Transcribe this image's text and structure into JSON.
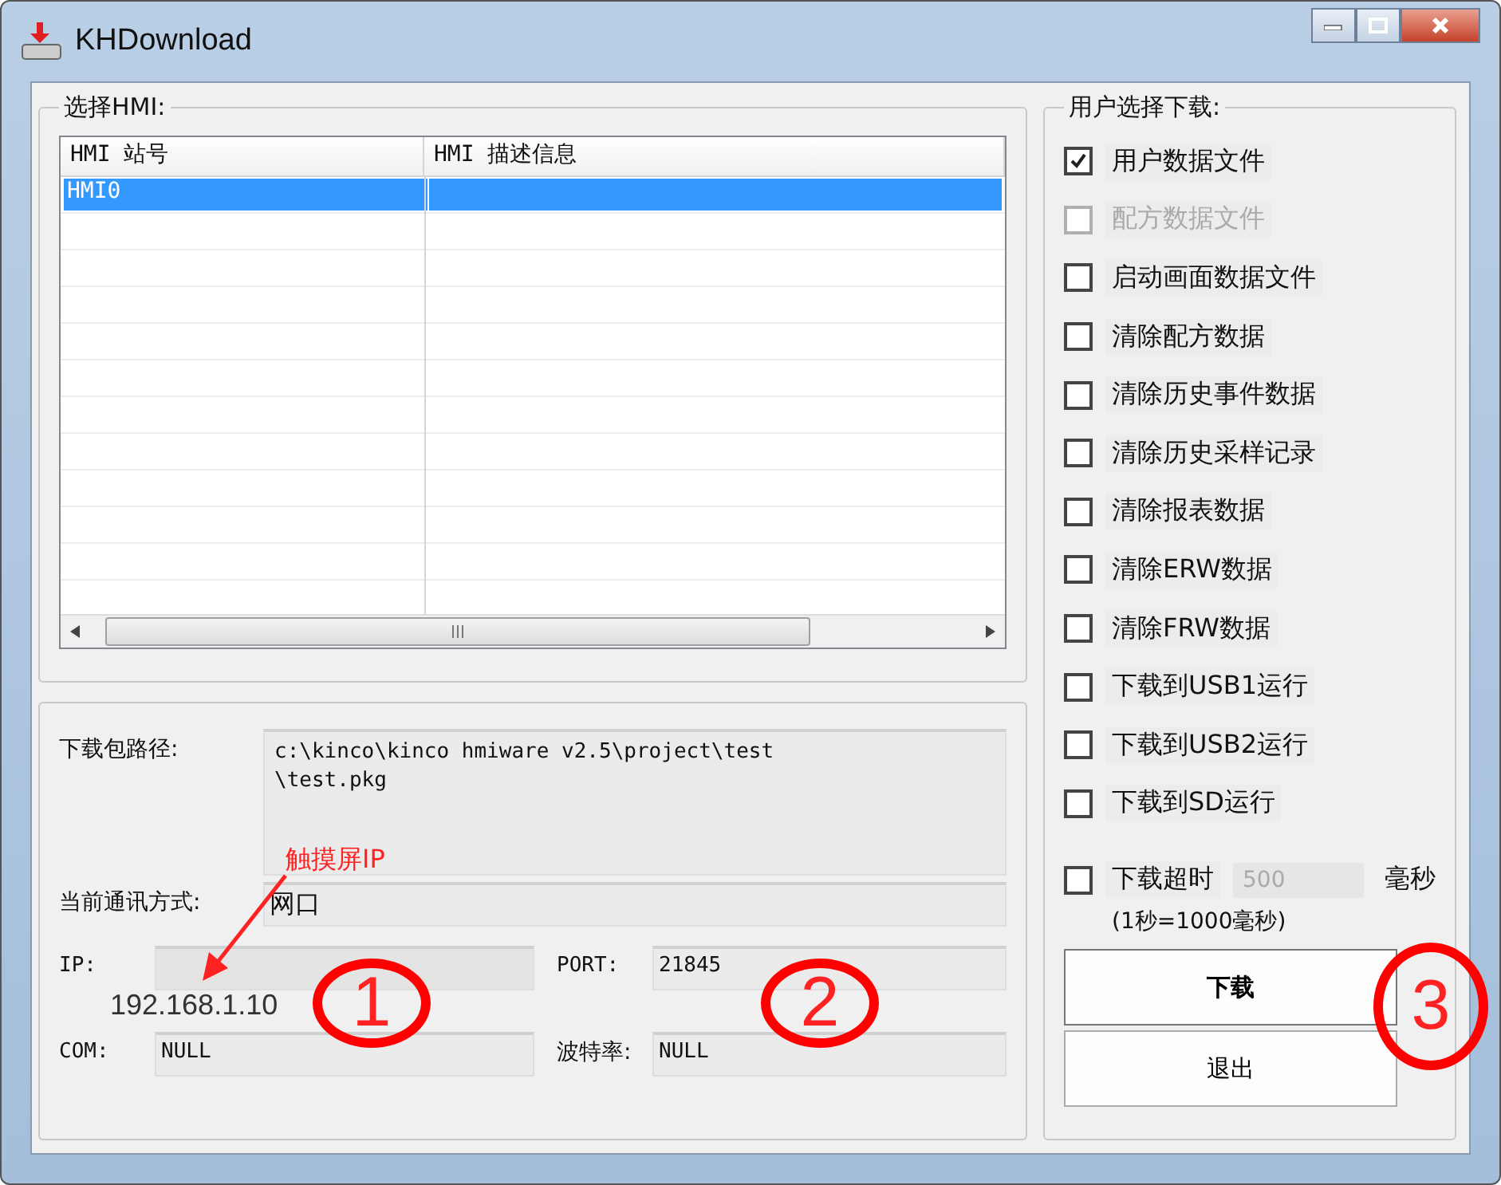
{
  "window": {
    "title": "KHDownload"
  },
  "hmi_group": {
    "title": "选择HMI:",
    "columns": [
      "HMI 站号",
      "HMI 描述信息"
    ],
    "rows": [
      {
        "station": "HMI0",
        "selected": true
      }
    ]
  },
  "connection": {
    "path_label": "下载包路径:",
    "path_value": "c:\\kinco\\kinco hmiware v2.5\\project\\test\n\\test.pkg",
    "mode_label": "当前通讯方式:",
    "mode_value": "网口",
    "ip_label": "IP:",
    "port_label": "PORT:",
    "port_value": "21845",
    "com_label": "COM:",
    "com_value": "NULL",
    "baud_label": "波特率:",
    "baud_value": "NULL"
  },
  "download_options": {
    "title": "用户选择下载:",
    "options": [
      {
        "label": "用户数据文件",
        "checked": true,
        "disabled": false
      },
      {
        "label": "配方数据文件",
        "checked": false,
        "disabled": true
      },
      {
        "label": "启动画面数据文件",
        "checked": false,
        "disabled": false
      },
      {
        "label": "清除配方数据",
        "checked": false,
        "disabled": false
      },
      {
        "label": "清除历史事件数据",
        "checked": false,
        "disabled": false
      },
      {
        "label": "清除历史采样记录",
        "checked": false,
        "disabled": false
      },
      {
        "label": "清除报表数据",
        "checked": false,
        "disabled": false
      },
      {
        "label": "清除ERW数据",
        "checked": false,
        "disabled": false
      },
      {
        "label": "清除FRW数据",
        "checked": false,
        "disabled": false
      },
      {
        "label": "下载到USB1运行",
        "checked": false,
        "disabled": false
      },
      {
        "label": "下载到USB2运行",
        "checked": false,
        "disabled": false
      },
      {
        "label": "下载到SD运行",
        "checked": false,
        "disabled": false
      }
    ],
    "timeout": {
      "label": "下载超时",
      "checked": false,
      "value": "500",
      "unit": "毫秒",
      "note": "(1秒=1000毫秒)"
    },
    "buttons": [
      {
        "label": "下载",
        "default": true
      },
      {
        "label": "退出",
        "default": false
      }
    ]
  },
  "annotations": {
    "ip_callout": "触摸屏IP",
    "ip_text": "192.168.1.10",
    "markers": [
      "1",
      "2",
      "3"
    ]
  }
}
